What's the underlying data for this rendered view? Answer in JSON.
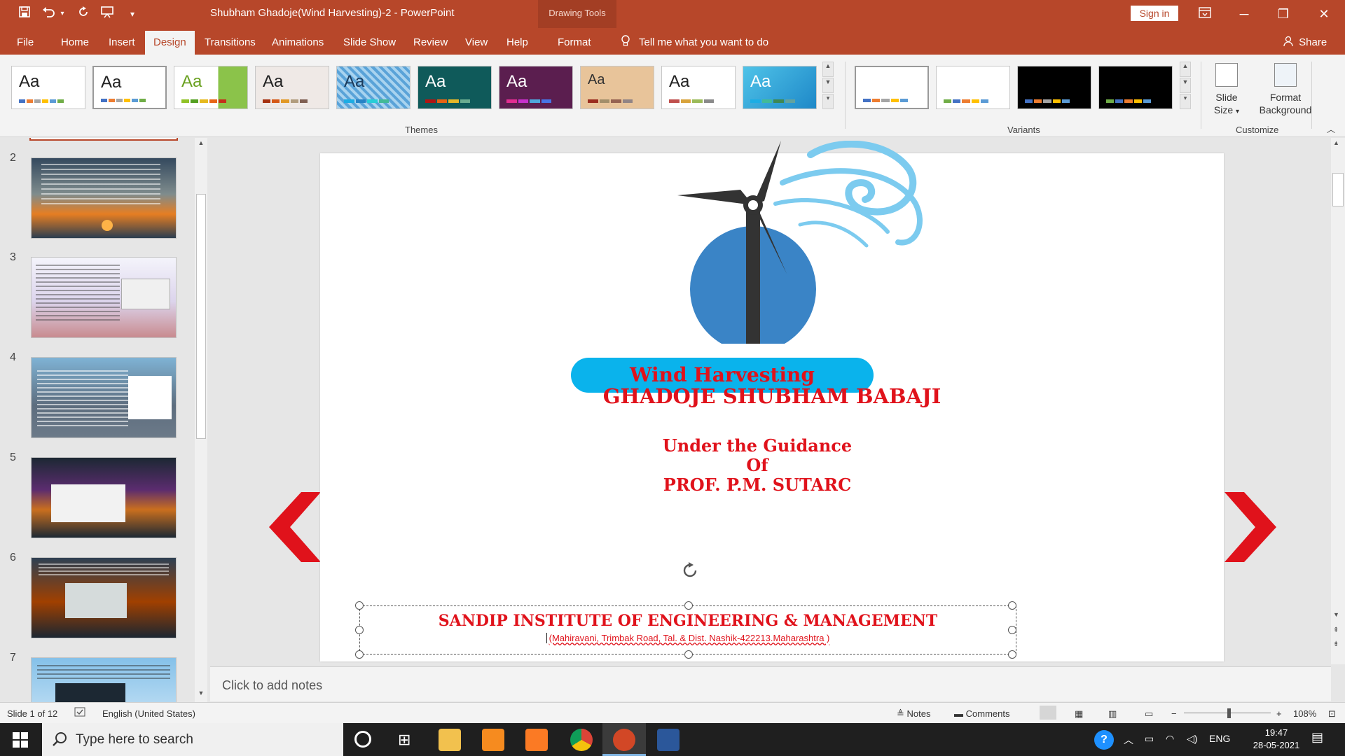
{
  "window": {
    "title": "Shubham Ghadoje(Wind Harvesting)-2  -  PowerPoint",
    "contextual_tab_group": "Drawing Tools",
    "sign_in": "Sign in"
  },
  "qat": {
    "save_icon": "save-icon",
    "undo_icon": "undo-icon",
    "redo_icon": "repeat-icon",
    "present_icon": "present-from-beginning-icon",
    "customize_icon": "customize-qat-icon"
  },
  "tabs": [
    "File",
    "Home",
    "Insert",
    "Design",
    "Transitions",
    "Animations",
    "Slide Show",
    "Review",
    "View",
    "Help",
    "Format"
  ],
  "active_tab": "Design",
  "tell_me": "Tell me what you want to do",
  "share": "Share",
  "ribbon": {
    "themes_label": "Themes",
    "variants_label": "Variants",
    "customize_label": "Customize",
    "theme_sample": "Aa",
    "slide_size_line1": "Slide",
    "slide_size_line2": "Size",
    "format_background_line1": "Format",
    "format_background_line2": "Background"
  },
  "thumbnails": {
    "numbers": [
      "2",
      "3",
      "4",
      "5",
      "6",
      "7"
    ]
  },
  "slide": {
    "title": "Wind Harvesting",
    "author": "GHADOJE SHUBHAM BABAJI",
    "guidance_line1": "Under the Guidance",
    "guidance_line2": "Of",
    "guidance_line3": "PROF. P.M. SUTARC",
    "institute": "SANDIP INSTITUTE OF ENGINEERING & MANAGEMENT",
    "address": "(Mahiravani, Trimbak Road, Tal. & Dist. Nashik-422213.Maharashtra  )",
    "logo_icon": "wind-turbine-logo-icon"
  },
  "notes_placeholder": "Click to add notes",
  "status": {
    "slide_of": "Slide 1 of 12",
    "language": "English (United States)",
    "notes": "Notes",
    "comments": "Comments",
    "zoom": "108%"
  },
  "taskbar": {
    "search_placeholder": "Type here to search",
    "language": "ENG",
    "time": "19:47",
    "date": "28-05-2021"
  },
  "colors": {
    "powerpoint_red": "#b7472a",
    "slide_text_red": "#e0121b",
    "pill_blue": "#0ab3ec",
    "wind_blue": "#7ccbef",
    "globe_blue": "#3a84c6"
  }
}
